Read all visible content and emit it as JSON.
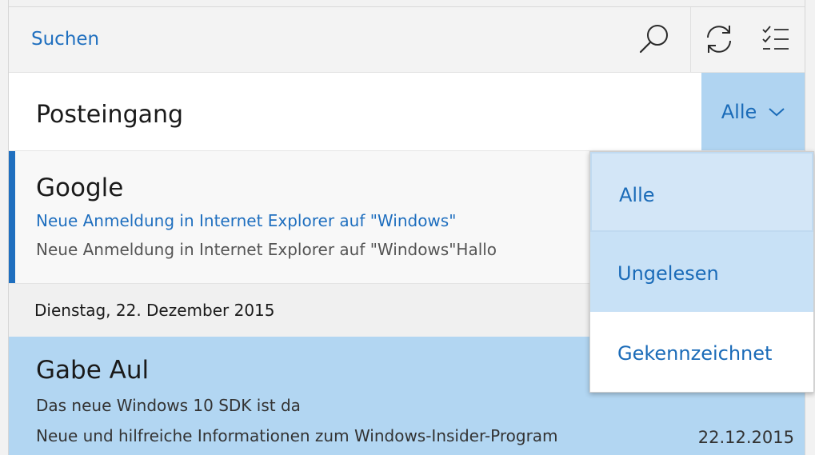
{
  "search": {
    "label": "Suchen"
  },
  "header": {
    "title": "Posteingang",
    "filter_label": "Alle"
  },
  "filter_menu": {
    "options": [
      "Alle",
      "Ungelesen",
      "Gekennzeichnet"
    ]
  },
  "messages": [
    {
      "sender": "Google",
      "subject": "Neue Anmeldung in Internet Explorer auf \"Windows\"",
      "preview": "Neue Anmeldung in Internet Explorer auf \"Windows\"Hallo"
    },
    {
      "sender": "Gabe Aul",
      "subject": "Das neue Windows 10 SDK ist da",
      "preview": "Neue und hilfreiche Informationen zum Windows-Insider-Program",
      "date": "22.12.2015"
    }
  ],
  "date_group": "Dienstag, 22. Dezember 2015",
  "colors": {
    "accent": "#1f6fbf",
    "selected_bg": "#b2d6f2",
    "filter_bg": "#b0d4f1"
  }
}
